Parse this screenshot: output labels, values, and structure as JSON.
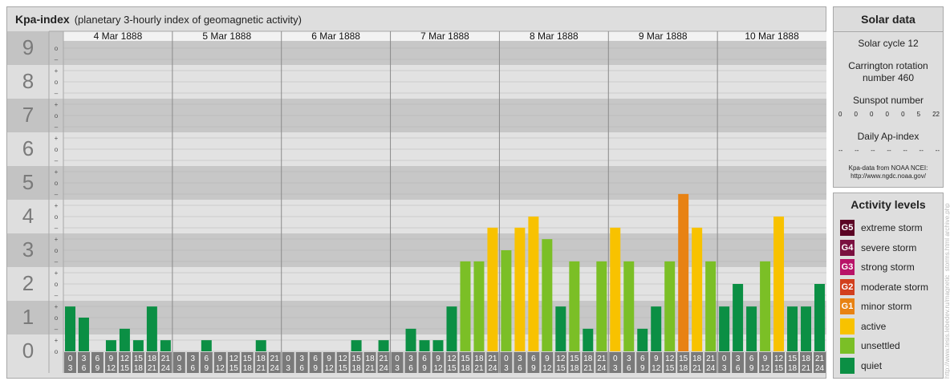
{
  "header": {
    "title": "Kpa-index",
    "subtitle": "(planetary 3-hourly index of geomagnetic activity)"
  },
  "chart_data": {
    "type": "bar",
    "title": "Kpa-index",
    "subtitle": "(planetary 3-hourly index of geomagnetic activity)",
    "ylim": [
      0,
      9
    ],
    "y_major_ticks": [
      "0",
      "1",
      "2",
      "3",
      "4",
      "5",
      "6",
      "7",
      "8",
      "9"
    ],
    "y_minor_ticks": [
      "o",
      "+",
      "–"
    ],
    "days": [
      "4 Mar 1888",
      "5 Mar 1888",
      "6 Mar 1888",
      "7 Mar 1888",
      "8 Mar 1888",
      "9 Mar 1888",
      "10 Mar 1888"
    ],
    "interval_start": [
      "0",
      "3",
      "6",
      "9",
      "12",
      "15",
      "18",
      "21"
    ],
    "interval_end": [
      "3",
      "6",
      "9",
      "12",
      "15",
      "18",
      "21",
      "24"
    ],
    "values": [
      [
        1.33,
        1.0,
        0,
        0.33,
        0.67,
        0.33,
        1.33,
        0.33
      ],
      [
        0,
        0,
        0.33,
        0,
        0,
        0,
        0.33,
        0
      ],
      [
        0,
        0,
        0,
        0,
        0,
        0.33,
        0,
        0.33
      ],
      [
        0,
        0.67,
        0.33,
        0.33,
        1.33,
        2.67,
        2.67,
        3.67
      ],
      [
        3.0,
        3.67,
        4.0,
        3.33,
        1.33,
        2.67,
        0.67,
        2.67
      ],
      [
        3.67,
        2.67,
        0.67,
        1.33,
        2.67,
        4.67,
        3.67,
        2.67
      ],
      [
        1.33,
        2.0,
        1.33,
        2.67,
        4.0,
        1.33,
        1.33,
        2.0
      ]
    ],
    "level_colors": {
      "quiet": "#0b8f44",
      "unsettled": "#7bbf26",
      "active": "#f8c200",
      "G1": "#e88213",
      "G2": "#d2401f",
      "G3": "#b81368",
      "G4": "#7a1040",
      "G5": "#5b0424"
    },
    "grid": true
  },
  "solar_data": {
    "title": "Solar data",
    "solar_cycle": "Solar cycle 12",
    "carrington_line1": "Carrington rotation",
    "carrington_line2": "number 460",
    "sunspot_label": "Sunspot number",
    "sunspot_values": [
      "0",
      "0",
      "0",
      "0",
      "0",
      "5",
      "22"
    ],
    "ap_label": "Daily Ap-index",
    "ap_values": [
      "--",
      "--",
      "--",
      "--",
      "--",
      "--",
      "--"
    ],
    "source_line1": "Kpa-data from NOAA NCEI:",
    "source_line2": "http://www.ngdc.noaa.gov/"
  },
  "activity_levels": {
    "title": "Activity levels",
    "items": [
      {
        "code": "G5",
        "label": "extreme storm",
        "color": "#5b0424"
      },
      {
        "code": "G4",
        "label": "severe storm",
        "color": "#7a1040"
      },
      {
        "code": "G3",
        "label": "strong storm",
        "color": "#b81368"
      },
      {
        "code": "G2",
        "label": "moderate storm",
        "color": "#d2401f"
      },
      {
        "code": "G1",
        "label": "minor storm",
        "color": "#e88213"
      },
      {
        "code": "",
        "label": "active",
        "color": "#f8c200"
      },
      {
        "code": "",
        "label": "unsettled",
        "color": "#7bbf26"
      },
      {
        "code": "",
        "label": "quiet",
        "color": "#0b8f44"
      }
    ]
  },
  "watermark": "http://www.tesis.lebedev.ru/magnetic_storms.html archive.php"
}
